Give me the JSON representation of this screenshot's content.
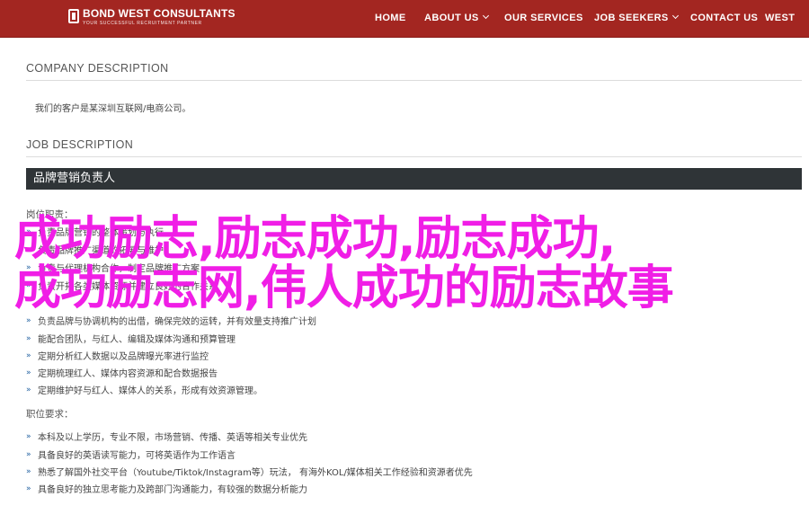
{
  "header": {
    "logo_name": "BOND WEST CONSULTANTS",
    "logo_tagline": "YOUR SUCCESSFUL RECRUITMENT PARTNER",
    "nav": [
      {
        "label": "HOME"
      },
      {
        "label": "ABOUT US"
      },
      {
        "label": "OUR SERVICES"
      },
      {
        "label": "JOB SEEKERS"
      },
      {
        "label": "CONTACT US"
      },
      {
        "label": "WEST"
      }
    ]
  },
  "company": {
    "heading": "COMPANY DESCRIPTION",
    "text": "我们的客户是某深圳互联网/电商公司。"
  },
  "job": {
    "heading": "JOB DESCRIPTION",
    "position_title": "品牌营销负责人",
    "duties_title": "岗位职责：",
    "duties": [
      "负责品牌营销的整体策划与执行",
      "负责品牌推广渠道的拓展与维护",
      "负责与代理机构合作，制定品牌推广方案",
      "负责开拓各类媒体资源并建立良好的合作关系",
      "负责品牌与协调机构的出借，确保完效的运转，并有效量支持推广计划",
      "能配合团队，与红人、编辑及媒体沟通和预算管理",
      "定期分析红人数据以及品牌曝光率进行监控",
      "定期梳理红人、媒体内容资源和配合数据报告",
      "定期维护好与红人、媒体人的关系，形成有效资源管理。"
    ],
    "req_title": "职位要求：",
    "requirements": [
      "本科及以上学历，专业不限，市场营销、传播、英语等相关专业优先",
      "具备良好的英语读写能力，可将英语作为工作语言",
      "熟悉了解国外社交平台（Youtube/Tiktok/Instagram等）玩法， 有海外KOL/媒体相关工作经验和资源者优先",
      "具备良好的独立思考能力及跨部门沟通能力，有较强的数据分析能力"
    ]
  },
  "overlay": {
    "line1": "成功励志,励志成功,励志成功,",
    "line2": "成功励志网,伟人成功的励志故事"
  },
  "colors": {
    "header_bg": "#a32621",
    "overlay_text": "#f01ee6",
    "dark_bar": "#2f3437",
    "bullet": "#1f5fa0"
  }
}
